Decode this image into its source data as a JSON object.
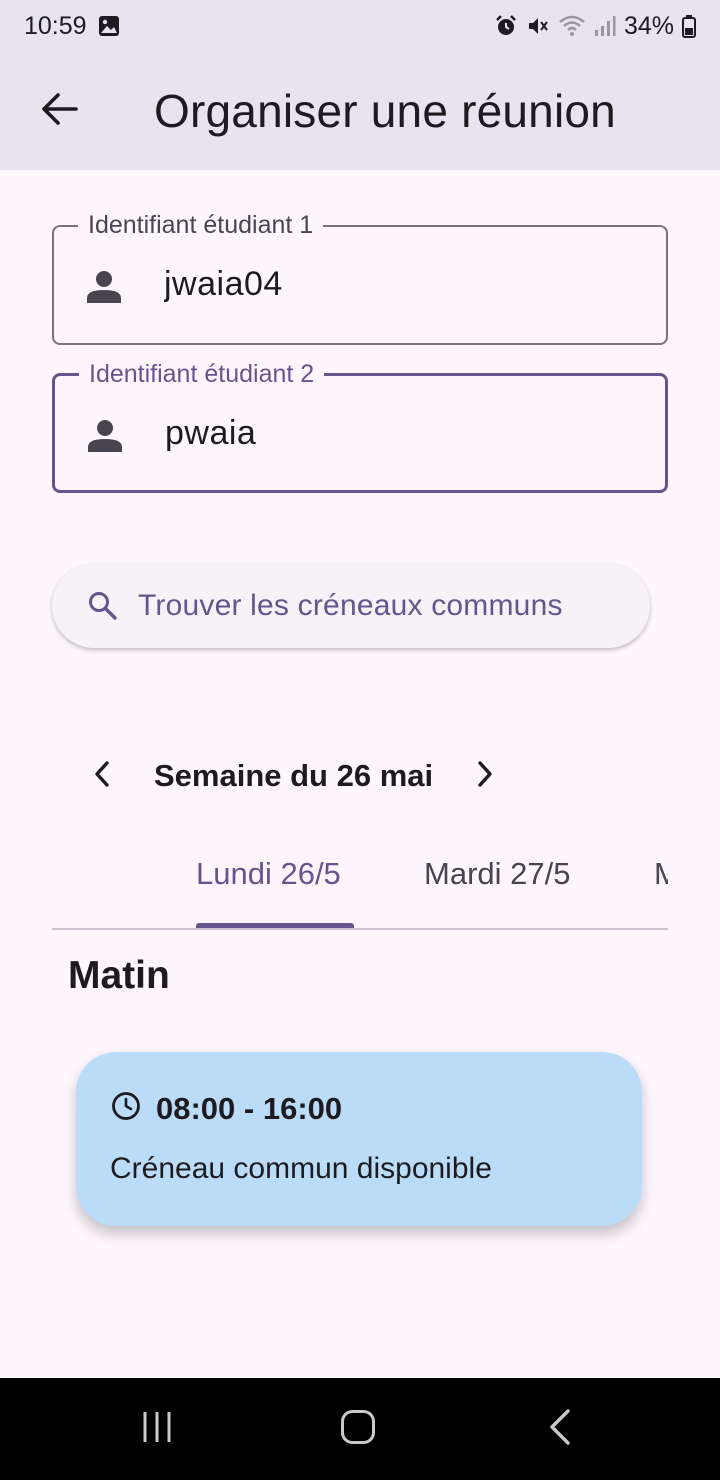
{
  "status_bar": {
    "time": "10:59",
    "battery": "34%"
  },
  "app_bar": {
    "title": "Organiser une réunion"
  },
  "form": {
    "student1": {
      "label": "Identifiant étudiant 1",
      "value": "jwaia04"
    },
    "student2": {
      "label": "Identifiant étudiant 2",
      "value": "pwaia"
    },
    "find_button": "Trouver les créneaux communs"
  },
  "week_nav": {
    "label": "Semaine du 26 mai"
  },
  "tabs": [
    {
      "label": "Lundi 26/5",
      "active": true
    },
    {
      "label": "Mardi 27/5",
      "active": false
    },
    {
      "label": "M",
      "active": false
    }
  ],
  "section": {
    "title": "Matin"
  },
  "slot": {
    "time": "08:00 - 16:00",
    "description": "Créneau commun disponible"
  },
  "colors": {
    "primary": "#65558f",
    "app_bar_bg": "#e8e4ef",
    "page_bg": "#fdf7fd",
    "slot_card_bg": "#bbdcf8"
  },
  "icons": {
    "back": "arrow-back-icon",
    "person": "person-icon",
    "search": "search-icon",
    "prev": "chevron-left-icon",
    "next": "chevron-right-icon",
    "clock": "clock-icon"
  }
}
